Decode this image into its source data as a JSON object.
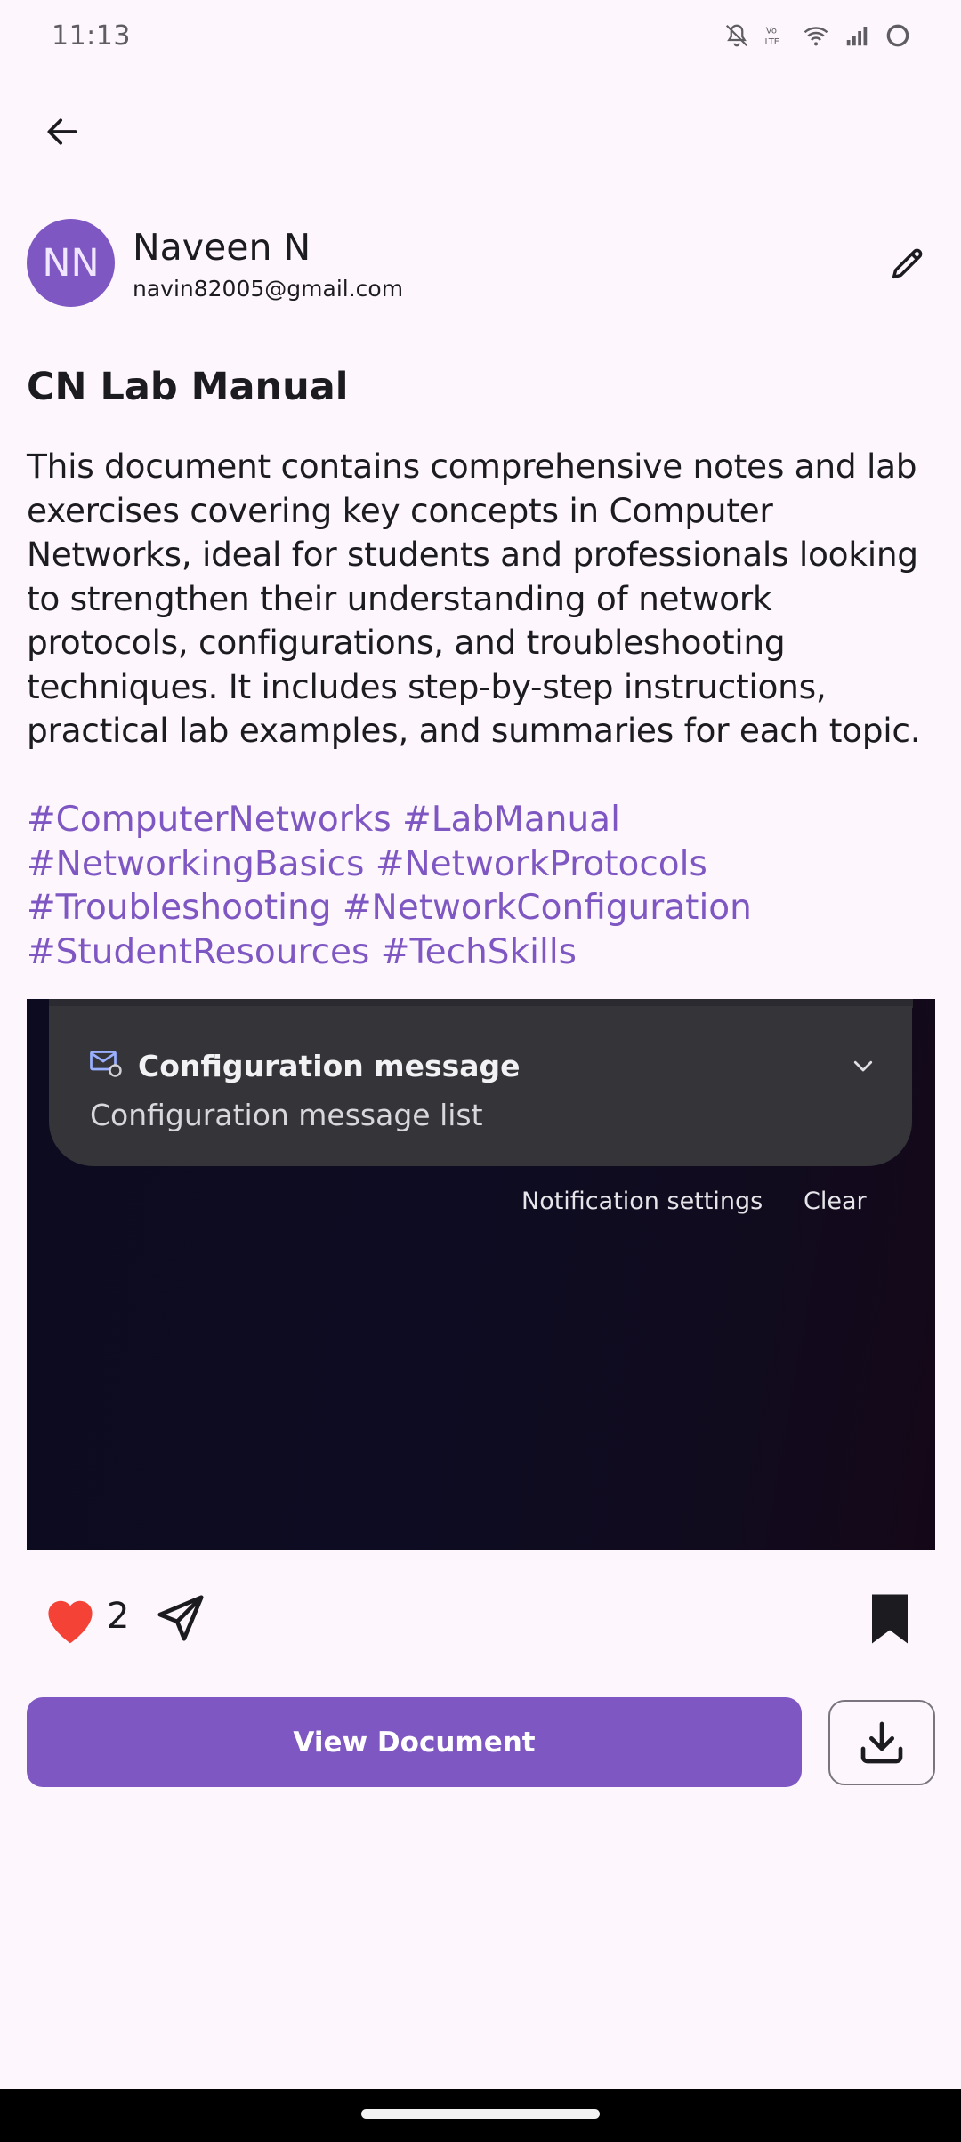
{
  "status_bar": {
    "time": "11:13",
    "icons": [
      "mute-bell-icon",
      "volte-icon",
      "wifi-icon",
      "signal-icon",
      "loading-ring-icon"
    ]
  },
  "header": {
    "back_icon": "arrow-left-icon"
  },
  "author": {
    "initials": "NN",
    "name": "Naveen N",
    "email": "navin82005@gmail.com",
    "edit_icon": "pencil-icon"
  },
  "post": {
    "title": "CN Lab Manual",
    "description": "This document contains comprehensive notes and lab exercises covering key concepts in Computer Networks, ideal for students and professionals looking to strengthen their understanding of network protocols, configurations, and troubleshooting techniques. It includes step-by-step instructions, practical lab examples, and summaries for each topic.",
    "hashtags": [
      "#ComputerNetworks",
      "#LabManual",
      "#NetworkingBasics",
      "#NetworkProtocols",
      "#Troubleshooting",
      "#NetworkConfiguration",
      "#StudentResources",
      "#TechSkills"
    ]
  },
  "preview": {
    "notification_title": "Configuration message",
    "notification_body": "Configuration message list",
    "notification_settings": "Notification settings",
    "clear": "Clear"
  },
  "actions": {
    "like_count": "2",
    "liked": true,
    "bookmarked": true
  },
  "buttons": {
    "view_document": "View Document",
    "download_icon": "download-icon"
  },
  "colors": {
    "accent": "#7e57c2",
    "like": "#f44336",
    "background": "#fdf7fd"
  }
}
